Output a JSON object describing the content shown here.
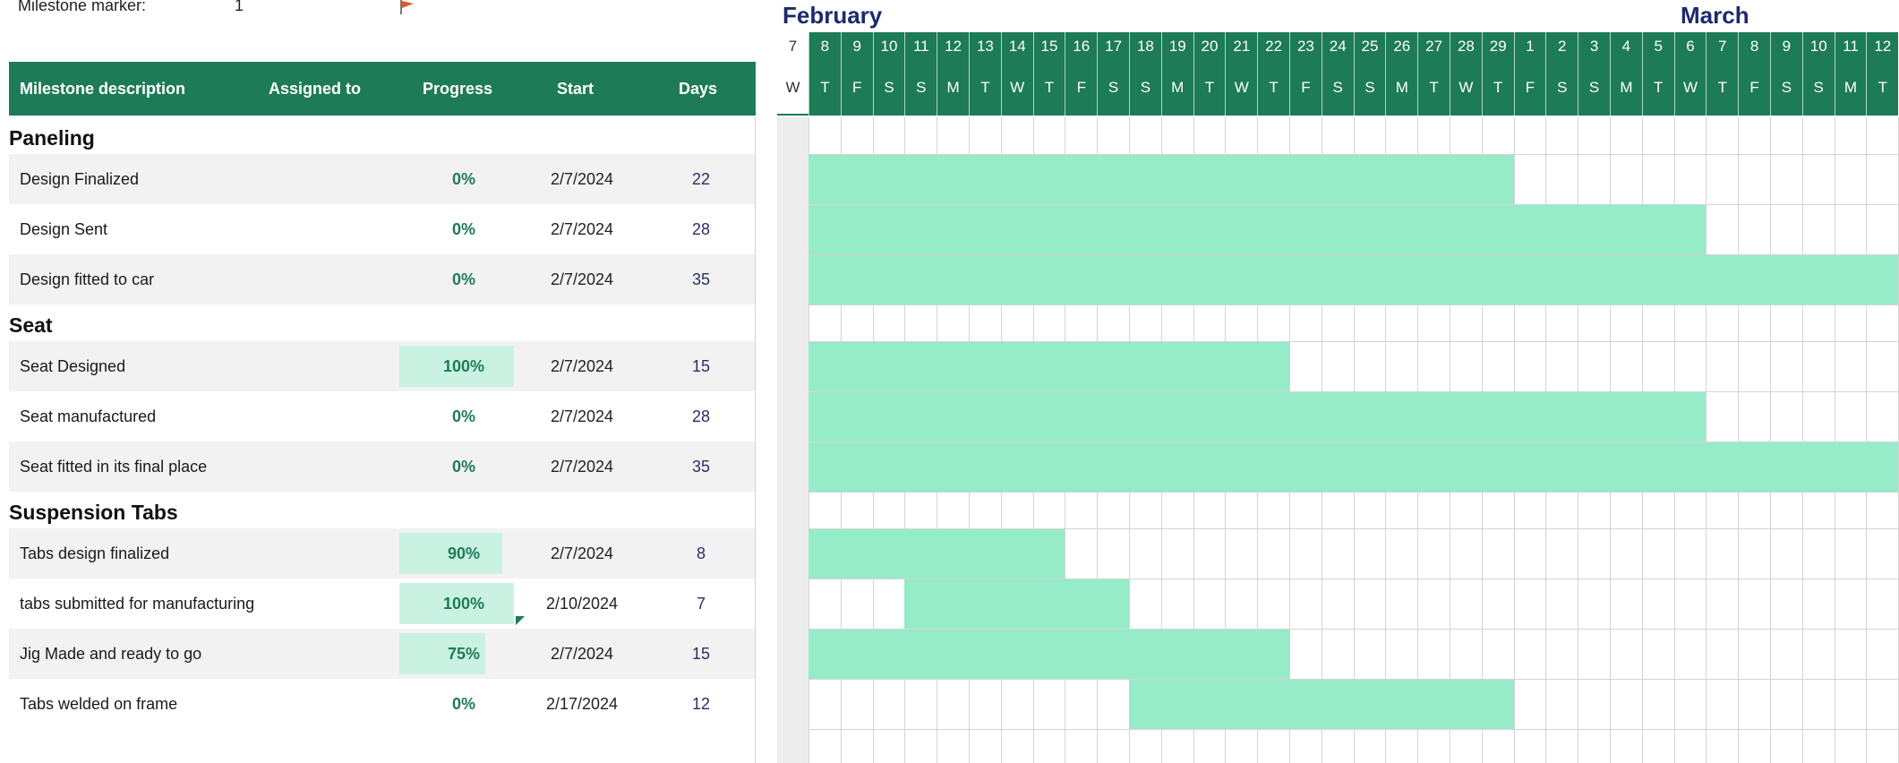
{
  "top": {
    "marker_label": "Milestone marker:",
    "marker_value": "1",
    "flag_color": "#e05a2c"
  },
  "headers": {
    "desc": "Milestone description",
    "assigned": "Assigned to",
    "progress": "Progress",
    "start": "Start",
    "days": "Days"
  },
  "months": {
    "feb": "February",
    "mar": "March"
  },
  "days": [
    {
      "n": "7",
      "d": "W"
    },
    {
      "n": "8",
      "d": "T"
    },
    {
      "n": "9",
      "d": "F"
    },
    {
      "n": "10",
      "d": "S"
    },
    {
      "n": "11",
      "d": "S"
    },
    {
      "n": "12",
      "d": "M"
    },
    {
      "n": "13",
      "d": "T"
    },
    {
      "n": "14",
      "d": "W"
    },
    {
      "n": "15",
      "d": "T"
    },
    {
      "n": "16",
      "d": "F"
    },
    {
      "n": "17",
      "d": "S"
    },
    {
      "n": "18",
      "d": "S"
    },
    {
      "n": "19",
      "d": "M"
    },
    {
      "n": "20",
      "d": "T"
    },
    {
      "n": "21",
      "d": "W"
    },
    {
      "n": "22",
      "d": "T"
    },
    {
      "n": "23",
      "d": "F"
    },
    {
      "n": "24",
      "d": "S"
    },
    {
      "n": "25",
      "d": "S"
    },
    {
      "n": "26",
      "d": "M"
    },
    {
      "n": "27",
      "d": "T"
    },
    {
      "n": "28",
      "d": "W"
    },
    {
      "n": "29",
      "d": "T"
    },
    {
      "n": "1",
      "d": "F"
    },
    {
      "n": "2",
      "d": "S"
    },
    {
      "n": "3",
      "d": "S"
    },
    {
      "n": "4",
      "d": "M"
    },
    {
      "n": "5",
      "d": "T"
    },
    {
      "n": "6",
      "d": "W"
    },
    {
      "n": "7",
      "d": "T"
    },
    {
      "n": "8",
      "d": "F"
    },
    {
      "n": "9",
      "d": "S"
    },
    {
      "n": "10",
      "d": "S"
    },
    {
      "n": "11",
      "d": "M"
    },
    {
      "n": "12",
      "d": "T"
    }
  ],
  "sections": [
    {
      "title": "Paneling",
      "tasks": [
        {
          "desc": "Design Finalized",
          "progress": "0%",
          "progress_value": 0,
          "start": "2/7/2024",
          "days": "22",
          "offset": 0
        },
        {
          "desc": "Design Sent",
          "progress": "0%",
          "progress_value": 0,
          "start": "2/7/2024",
          "days": "28",
          "offset": 0
        },
        {
          "desc": "Design fitted to car",
          "progress": "0%",
          "progress_value": 0,
          "start": "2/7/2024",
          "days": "35",
          "offset": 0
        }
      ]
    },
    {
      "title": "Seat",
      "tasks": [
        {
          "desc": "Seat Designed",
          "progress": "100%",
          "progress_value": 100,
          "start": "2/7/2024",
          "days": "15",
          "offset": 0
        },
        {
          "desc": "Seat manufactured",
          "progress": "0%",
          "progress_value": 0,
          "start": "2/7/2024",
          "days": "28",
          "offset": 0
        },
        {
          "desc": "Seat fitted in its final place",
          "progress": "0%",
          "progress_value": 0,
          "start": "2/7/2024",
          "days": "35",
          "offset": 0
        }
      ]
    },
    {
      "title": "Suspension Tabs",
      "tasks": [
        {
          "desc": "Tabs design finalized",
          "progress": "90%",
          "progress_value": 90,
          "start": "2/7/2024",
          "days": "8",
          "offset": 0
        },
        {
          "desc": "tabs submitted for manufacturing",
          "progress": "100%",
          "progress_value": 100,
          "start": "2/10/2024",
          "days": "7",
          "offset": 3
        },
        {
          "desc": "Jig Made and ready to go",
          "progress": "75%",
          "progress_value": 75,
          "start": "2/7/2024",
          "days": "15",
          "offset": 0
        },
        {
          "desc": "Tabs welded on frame",
          "progress": "0%",
          "progress_value": 0,
          "start": "2/17/2024",
          "days": "12",
          "offset": 10
        }
      ]
    }
  ],
  "colors": {
    "header_green": "#1e7b57",
    "bar_mint": "#96ebc8",
    "progress_fill": "#c9f2e2",
    "month_navy": "#1c2b6b"
  }
}
